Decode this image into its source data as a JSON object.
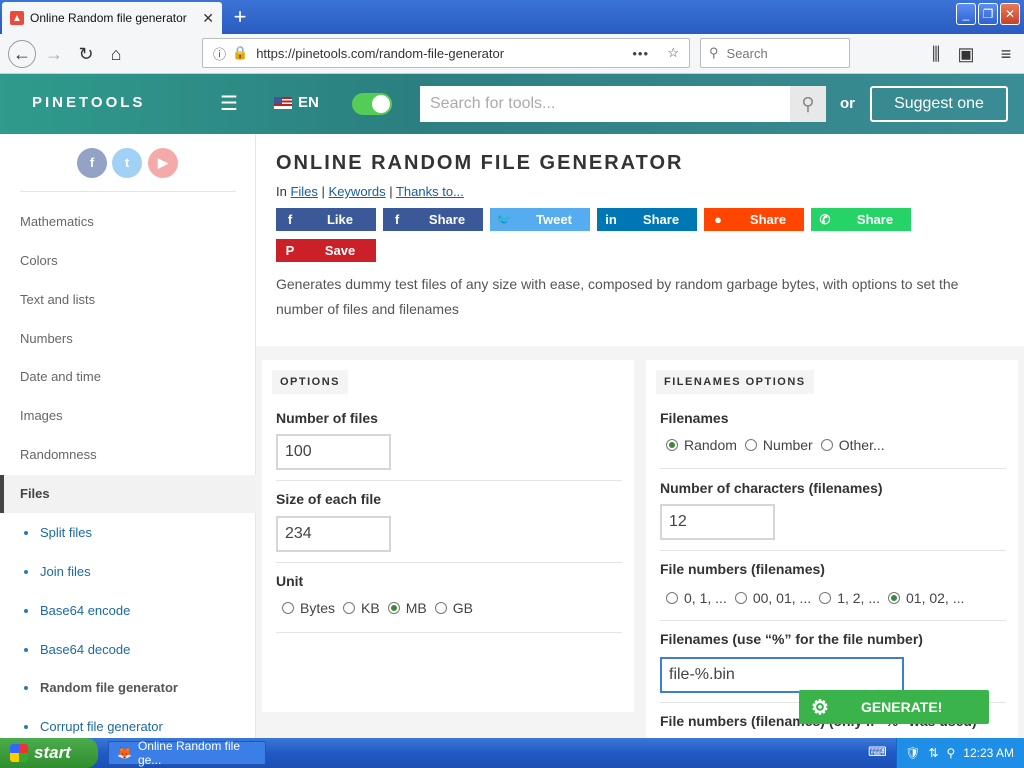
{
  "browser": {
    "tab_title": "Online Random file generator",
    "tab_close": "✕",
    "new_tab": "+",
    "url": "https://pinetools.com/random-file-generator",
    "url_menu": "•••",
    "search_placeholder": "Search"
  },
  "site": {
    "logo": "PINETOOLS",
    "lang": "EN",
    "search_placeholder": "Search for tools...",
    "or_label": "or",
    "suggest_label": "Suggest one"
  },
  "sidebar": {
    "social": [
      "f",
      "t",
      "▶"
    ],
    "categories": [
      "Mathematics",
      "Colors",
      "Text and lists",
      "Numbers",
      "Date and time",
      "Images",
      "Randomness",
      "Files"
    ],
    "active_category": "Files",
    "subitems": [
      "Split files",
      "Join files",
      "Base64 encode",
      "Base64 decode",
      "Random file generator",
      "Corrupt file generator"
    ],
    "current_subitem": "Random file generator"
  },
  "page": {
    "title": "ONLINE RANDOM FILE GENERATOR",
    "crumb_in": "In",
    "crumb_files": "Files",
    "crumb_keywords": "Keywords",
    "crumb_thanks": "Thanks to...",
    "share": [
      {
        "label": "Like",
        "icon": "f",
        "color": "#3b5998"
      },
      {
        "label": "Share",
        "icon": "f",
        "color": "#3b5998"
      },
      {
        "label": "Tweet",
        "icon": "🐦",
        "color": "#55acee"
      },
      {
        "label": "Share",
        "icon": "in",
        "color": "#0077b5"
      },
      {
        "label": "Share",
        "icon": "●",
        "color": "#ff4500"
      },
      {
        "label": "Share",
        "icon": "✆",
        "color": "#25d366"
      },
      {
        "label": "Save",
        "icon": "P",
        "color": "#cb2027"
      }
    ],
    "description": "Generates dummy test files of any size with ease, composed by random garbage bytes, with options to set the number of files and filenames"
  },
  "options": {
    "tag": "OPTIONS",
    "num_files_label": "Number of files",
    "num_files_value": "100",
    "size_label": "Size of each file",
    "size_value": "234",
    "unit_label": "Unit",
    "units": [
      "Bytes",
      "KB",
      "MB",
      "GB"
    ],
    "unit_selected": "MB"
  },
  "filenames": {
    "tag": "FILENAMES OPTIONS",
    "filenames_label": "Filenames",
    "filename_modes": [
      "Random",
      "Number",
      "Other..."
    ],
    "filename_mode_selected": "Random",
    "num_chars_label": "Number of characters (filenames)",
    "num_chars_value": "12",
    "file_numbers_label": "File numbers (filenames)",
    "number_formats": [
      "0, 1, ...",
      "00, 01, ...",
      "1, 2, ...",
      "01, 02, ..."
    ],
    "number_format_selected": "01, 02, ...",
    "pattern_label": "Filenames (use “%” for the file number)",
    "pattern_value": "file-%.bin",
    "partial_label": "File numbers (filenames) (only if “%” was used)"
  },
  "generate_label": "GENERATE!",
  "taskbar": {
    "start": "start",
    "task_item": "Online Random file ge...",
    "clock": "12:23 AM"
  }
}
